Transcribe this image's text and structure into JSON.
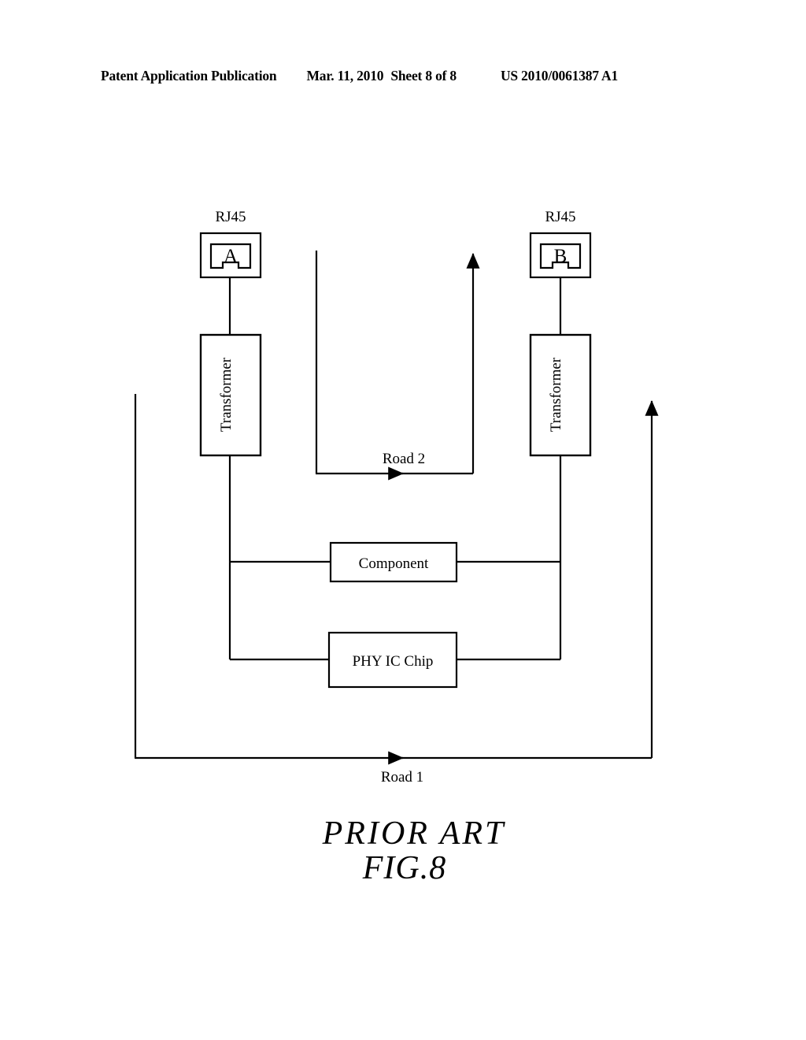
{
  "header": {
    "publication": "Patent Application Publication",
    "date": "Mar. 11, 2010",
    "sheet": "Sheet 8 of 8",
    "patent_number": "US 2010/0061387 A1"
  },
  "figure": {
    "caption_prior_art": "PRIOR ART",
    "caption_fig": "FIG.8",
    "connectors": [
      {
        "id": "left",
        "label": "RJ45",
        "letter": "A"
      },
      {
        "id": "right",
        "label": "RJ45",
        "letter": "B"
      }
    ],
    "blocks": [
      {
        "id": "transformer-left",
        "label": "Transformer"
      },
      {
        "id": "transformer-right",
        "label": "Transformer"
      },
      {
        "id": "component",
        "label": "Component"
      },
      {
        "id": "phy-ic-chip",
        "label": "PHY IC Chip"
      }
    ],
    "paths": [
      {
        "id": "road-1",
        "label": "Road 1"
      },
      {
        "id": "road-2",
        "label": "Road 2"
      }
    ]
  },
  "colors": {
    "ink": "#000000",
    "paper": "#ffffff"
  }
}
